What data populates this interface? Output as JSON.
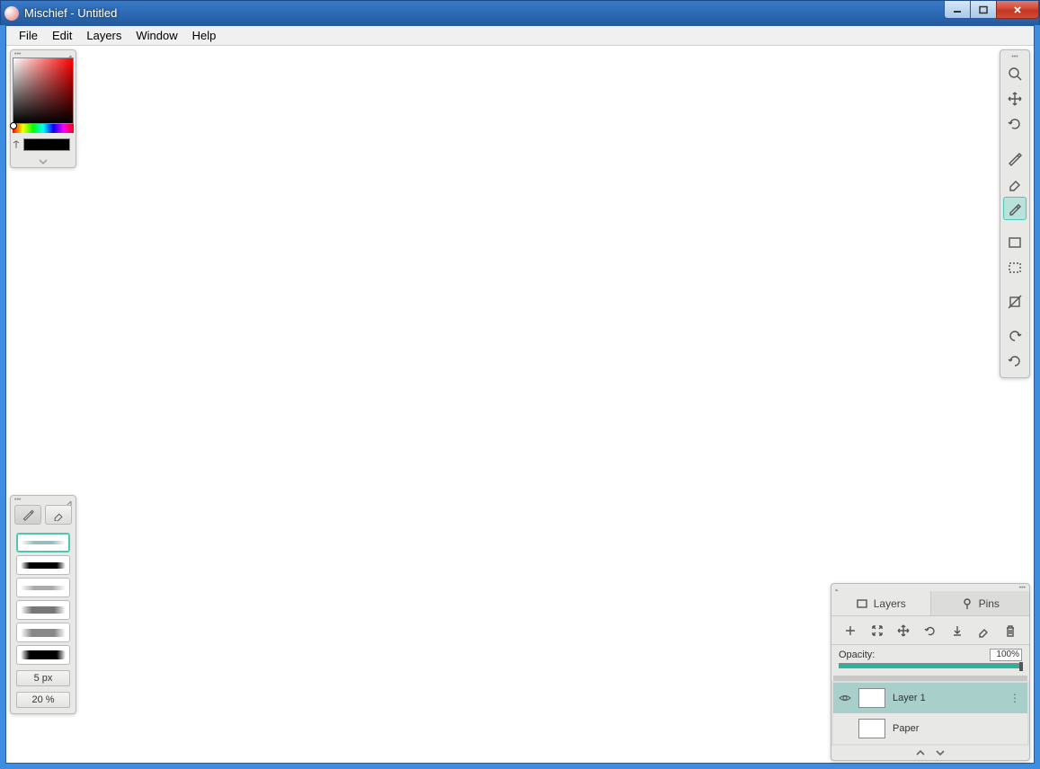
{
  "window": {
    "title": "Mischief - Untitled"
  },
  "menu": {
    "file": "File",
    "edit": "Edit",
    "layers": "Layers",
    "window": "Window",
    "help": "Help"
  },
  "color_panel": {
    "current": "#000000"
  },
  "brush_panel": {
    "size": "5 px",
    "opacity": "20 %"
  },
  "tools": [
    "zoom",
    "pan",
    "rotate",
    "pencil",
    "eraser",
    "eyedropper",
    "rectangle",
    "select",
    "crop",
    "undo",
    "redo"
  ],
  "layers_panel": {
    "tab_layers": "Layers",
    "tab_pins": "Pins",
    "opacity_label": "Opacity:",
    "opacity_value": "100%",
    "layers": [
      {
        "name": "Layer 1",
        "selected": true,
        "visible": true
      },
      {
        "name": "Paper",
        "selected": false,
        "visible": true
      }
    ]
  }
}
